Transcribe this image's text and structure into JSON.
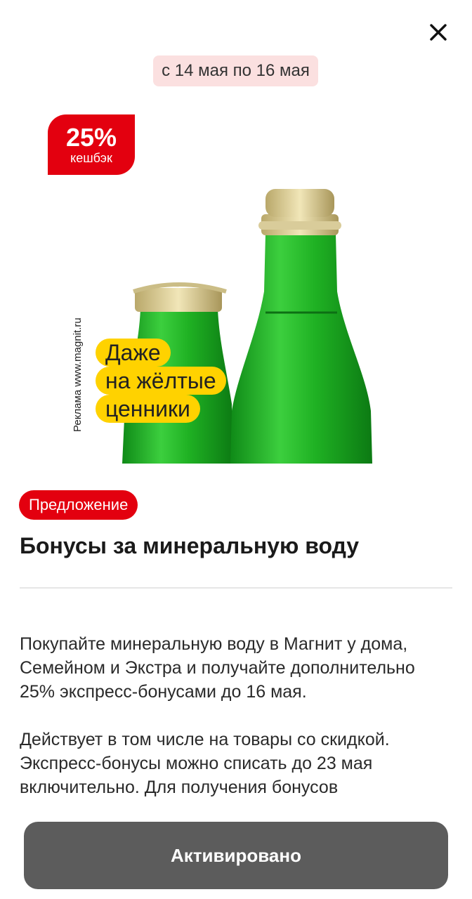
{
  "header": {
    "close_icon": "close-icon",
    "date_range": "с 14 мая по 16 мая"
  },
  "promo": {
    "cashback_percent": "25%",
    "cashback_label": "кешбэк",
    "ad_text": "Реклама www.magnit.ru",
    "label_lines": [
      "Даже",
      "на жёлтые",
      "ценники"
    ]
  },
  "offer": {
    "badge": "Предложение",
    "title": "Бонусы за минеральную воду",
    "paragraphs": [
      "Покупайте минеральную воду в Магнит у дома, Семейном и Экстра и получайте дополнительно 25% экспресс-бонусами до 16 мая.",
      "Действует в том числе на товары со скидкой. Экспресс-бонусы можно списать до 23 мая включительно. Для получения бонусов"
    ]
  },
  "footer": {
    "button_label": "Активировано"
  },
  "colors": {
    "brand_red": "#e3000f",
    "chip_bg": "#fbe0e0",
    "button_bg": "#5c5c5c",
    "label_yellow": "#ffd200",
    "bottle_green": "#1fa524"
  }
}
